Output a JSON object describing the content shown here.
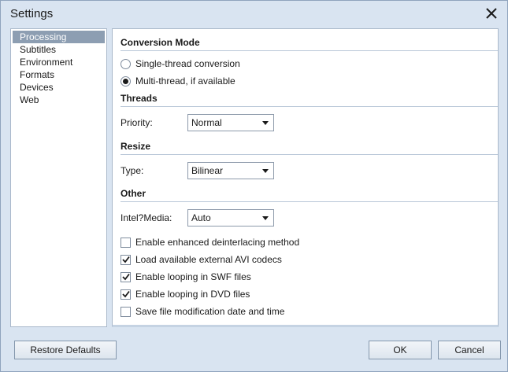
{
  "window": {
    "title": "Settings"
  },
  "sidebar": {
    "items": [
      {
        "label": "Processing",
        "selected": true
      },
      {
        "label": "Subtitles",
        "selected": false
      },
      {
        "label": "Environment",
        "selected": false
      },
      {
        "label": "Formats",
        "selected": false
      },
      {
        "label": "Devices",
        "selected": false
      },
      {
        "label": "Web",
        "selected": false
      }
    ]
  },
  "conversion_mode": {
    "heading": "Conversion Mode",
    "options": [
      {
        "label": "Single-thread conversion",
        "selected": false
      },
      {
        "label": "Multi-thread, if available",
        "selected": true
      }
    ]
  },
  "threads": {
    "heading": "Threads",
    "priority_label": "Priority:",
    "priority_value": "Normal"
  },
  "resize": {
    "heading": "Resize",
    "type_label": "Type:",
    "type_value": "Bilinear"
  },
  "other": {
    "heading": "Other",
    "media_label": "Intel?Media:",
    "media_value": "Auto",
    "checkboxes": [
      {
        "label": "Enable enhanced deinterlacing method",
        "checked": false
      },
      {
        "label": "Load available external AVI codecs",
        "checked": true
      },
      {
        "label": "Enable looping in SWF files",
        "checked": true
      },
      {
        "label": "Enable looping in DVD files",
        "checked": true
      },
      {
        "label": "Save file modification date and time",
        "checked": false
      }
    ]
  },
  "footer": {
    "restore_label": "Restore Defaults",
    "ok_label": "OK",
    "cancel_label": "Cancel"
  },
  "colors": {
    "window_bg": "#d9e4f1",
    "selected_item_bg": "#8d9eb2"
  }
}
